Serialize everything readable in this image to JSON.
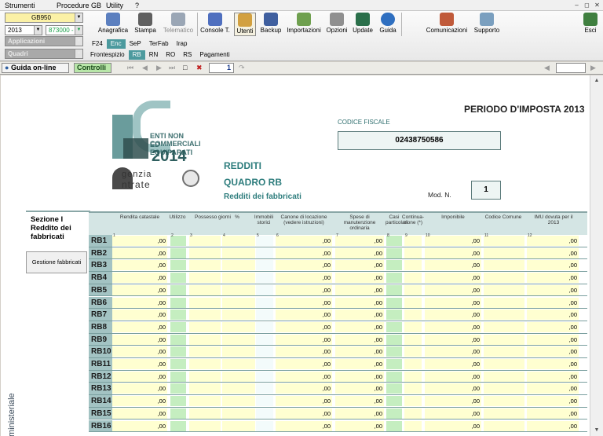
{
  "menu": {
    "items": [
      "Strumenti",
      "Procedure GB",
      "Utility",
      "?"
    ]
  },
  "toolbar": {
    "selectors": {
      "product": "GB950",
      "year": "2013",
      "code": "873000 -",
      "applications": "Applicazioni",
      "frames": "Quadri"
    },
    "buttons": [
      {
        "label": "Anagrafica",
        "color": "#5b7fbf"
      },
      {
        "label": "Stampa",
        "color": "#606060"
      },
      {
        "label": "Telematico",
        "color": "#9aa6b5"
      },
      {
        "label": "Console T.",
        "color": "#4f6fbf"
      },
      {
        "label": "Utenti",
        "color": "#d2a040"
      },
      {
        "label": "Backup",
        "color": "#3f5f9f"
      },
      {
        "label": "Importazioni",
        "color": "#6fa04f"
      },
      {
        "label": "Opzioni",
        "color": "#8f8f8f"
      },
      {
        "label": "Update",
        "color": "#2a6f4a"
      },
      {
        "label": "Guida",
        "color": "#2f6fc0"
      },
      {
        "label": "Comunicazioni",
        "color": "#c05a3a"
      },
      {
        "label": "Supporto",
        "color": "#7a9fbf"
      },
      {
        "label": "Esci",
        "color": "#3f7f3f"
      }
    ],
    "tabs_row1": [
      "F24",
      "Enc",
      "SeP",
      "TerFab",
      "Irap"
    ],
    "tabs_row2": [
      "Frontespizio",
      "RB",
      "RN",
      "RO",
      "RS",
      "Pagamenti"
    ]
  },
  "navbar": {
    "guide_label": "Guida on-line",
    "controls_label": "Controlli",
    "page_number": "1"
  },
  "header": {
    "logo_lines": [
      "ENTI NON COMMERCIALI",
      "ED EQUIPARATI"
    ],
    "logo_year": "2014",
    "agency_line1": "genzia",
    "agency_line2": "ntrate",
    "period_title": "PERIODO D'IMPOSTA 2013",
    "tax_code_label": "CODICE FISCALE",
    "tax_code_value": "02438750586",
    "titles": [
      "REDDITI",
      "QUADRO RB",
      "Redditi dei fabbricati"
    ],
    "mod_label": "Mod. N.",
    "mod_value": "1"
  },
  "section": {
    "title": "Sezione I\nReddito dei fabbricati",
    "button_label": "Gestione fabbricati",
    "side_text": "ministeriale"
  },
  "table": {
    "columns": [
      "Rendita catastale",
      "Utilizzo",
      "Possesso giorni",
      "%",
      "Immobili storici",
      "Canone di locazione (vedere istruzioni)",
      "Spese di manutenzione ordinaria",
      "Casi particolari",
      "Continua-zione (*)",
      "Imponibile",
      "Codice Comune",
      "IMU dovuta per il 2013"
    ],
    "col_nums": [
      "1",
      "2",
      "3",
      "4",
      "5",
      "6",
      "7",
      "8",
      "9",
      "10",
      "11",
      "12"
    ],
    "zero": ",00",
    "rows": [
      "RB1",
      "RB2",
      "RB3",
      "RB4",
      "RB5",
      "RB6",
      "RB7",
      "RB8",
      "RB9",
      "RB10",
      "RB11",
      "RB12",
      "RB13",
      "RB14",
      "RB15",
      "RB16"
    ]
  }
}
